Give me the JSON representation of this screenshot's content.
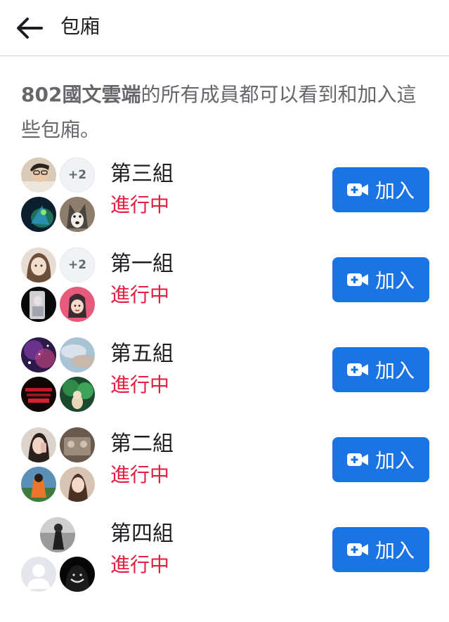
{
  "header": {
    "title": "包廂",
    "back_icon": "arrow-left-icon"
  },
  "description": {
    "group_name": "802國文雲端",
    "text": "的所有成員都可以看到和加入這些包廂。"
  },
  "colors": {
    "accent": "#1b74e4",
    "live": "#e41e3f",
    "muted": "#65676b"
  },
  "rooms": [
    {
      "name": "第三組",
      "status": "進行中",
      "extra": "+2",
      "join_label": "加入"
    },
    {
      "name": "第一組",
      "status": "進行中",
      "extra": "+2",
      "join_label": "加入"
    },
    {
      "name": "第五組",
      "status": "進行中",
      "join_label": "加入"
    },
    {
      "name": "第二組",
      "status": "進行中",
      "join_label": "加入"
    },
    {
      "name": "第四組",
      "status": "進行中",
      "join_label": "加入"
    }
  ]
}
